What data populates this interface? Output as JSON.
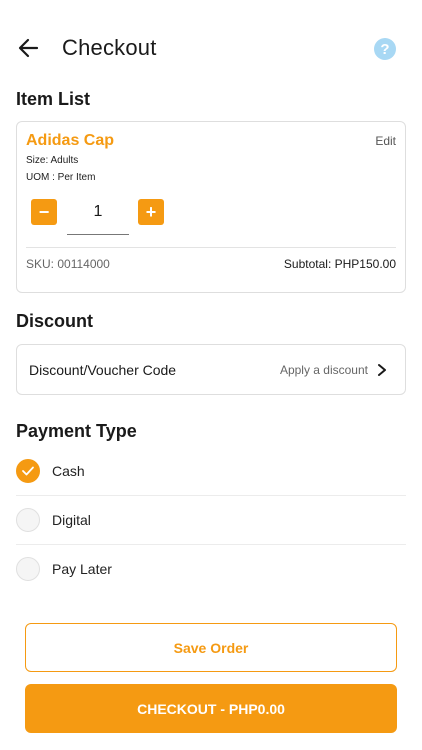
{
  "header": {
    "title": "Checkout",
    "back_icon": "arrow-left-icon",
    "help_icon": "question-circle-icon",
    "help_glyph": "?"
  },
  "item_list": {
    "title": "Item List",
    "items": [
      {
        "name": "Adidas Cap",
        "edit_label": "Edit",
        "size": "Size: Adults",
        "uom": "UOM : Per Item",
        "quantity": "1",
        "minus_glyph": "−",
        "plus_glyph": "+",
        "sku": "SKU: 00114000",
        "subtotal": "Subtotal: PHP150.00"
      }
    ]
  },
  "discount": {
    "title": "Discount",
    "label": "Discount/Voucher Code",
    "action": "Apply a discount"
  },
  "payment": {
    "title": "Payment Type",
    "options": [
      {
        "label": "Cash",
        "selected": true
      },
      {
        "label": "Digital",
        "selected": false
      },
      {
        "label": "Pay Later",
        "selected": false
      }
    ]
  },
  "actions": {
    "save_label": "Save Order",
    "checkout_label": "CHECKOUT - PHP0.00"
  },
  "colors": {
    "accent": "#f59a12",
    "help": "#a8d8f4"
  }
}
